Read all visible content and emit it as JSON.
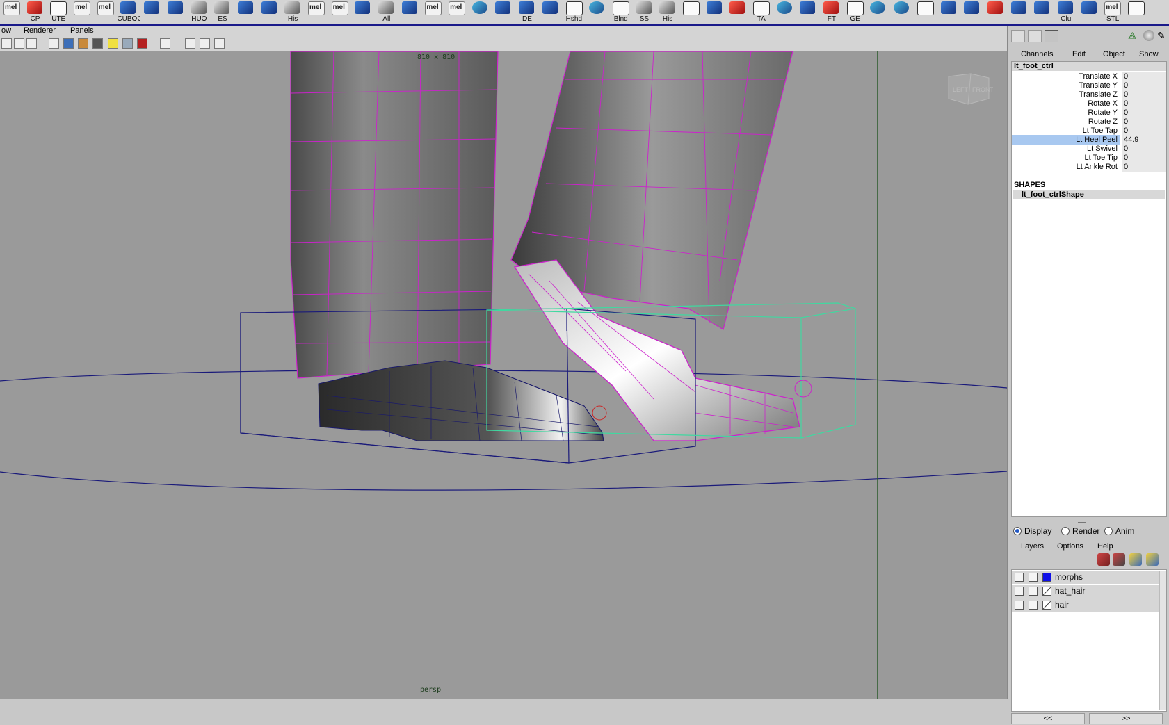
{
  "shelf": {
    "buttons": [
      {
        "label": "",
        "icon": "mel-script-icon",
        "style": "mel"
      },
      {
        "label": "CP",
        "icon": "arrow-red-icon",
        "style": "red"
      },
      {
        "label": "UTE",
        "icon": "window-icon",
        "style": "white"
      },
      {
        "label": "",
        "icon": "mel-script-icon",
        "style": "mel"
      },
      {
        "label": "",
        "icon": "mel-script-icon",
        "style": "mel"
      },
      {
        "label": "CUBOC",
        "icon": "cube-blue-icon",
        "style": "blue"
      },
      {
        "label": "",
        "icon": "plane-blue-icon",
        "style": "blue"
      },
      {
        "label": "",
        "icon": "sphere-wire-icon",
        "style": "blue"
      },
      {
        "label": "HUO",
        "icon": "triangle-gray-icon",
        "style": "gray"
      },
      {
        "label": "ES",
        "icon": "gun-icon",
        "style": "gray"
      },
      {
        "label": "",
        "icon": "bucket-blue-icon",
        "style": "blue"
      },
      {
        "label": "",
        "icon": "grid-blue-icon",
        "style": "blue"
      },
      {
        "label": "His",
        "icon": "flag-gray-icon",
        "style": "gray"
      },
      {
        "label": "",
        "icon": "mel-script-icon",
        "style": "mel"
      },
      {
        "label": "",
        "icon": "mel-script-icon",
        "style": "mel"
      },
      {
        "label": "",
        "icon": "plane-red-icon",
        "style": "blue"
      },
      {
        "label": "All",
        "icon": "triangle-gray-icon",
        "style": "gray"
      },
      {
        "label": "",
        "icon": "box-blue-icon",
        "style": "blue"
      },
      {
        "label": "",
        "icon": "mel-script-icon",
        "style": "mel"
      },
      {
        "label": "",
        "icon": "mel-script-icon",
        "style": "mel"
      },
      {
        "label": "",
        "icon": "joint-grid-icon",
        "style": "teal"
      },
      {
        "label": "",
        "icon": "grid-blue-icon",
        "style": "blue"
      },
      {
        "label": "DE",
        "icon": "plane-blue-icon",
        "style": "blue"
      },
      {
        "label": "",
        "icon": "cursor-grid-icon",
        "style": "blue"
      },
      {
        "label": "Hshd",
        "icon": "window-icon",
        "style": "white"
      },
      {
        "label": "",
        "icon": "sphere-cluster-icon",
        "style": "teal"
      },
      {
        "label": "Blnd",
        "icon": "window-icon",
        "style": "white"
      },
      {
        "label": "SS",
        "icon": "triangle-gray-icon",
        "style": "gray"
      },
      {
        "label": "His",
        "icon": "flag-gray-icon",
        "style": "gray"
      },
      {
        "label": "",
        "icon": "cube-wire-icon",
        "style": "white"
      },
      {
        "label": "",
        "icon": "helmet-blue-icon",
        "style": "blue"
      },
      {
        "label": "",
        "icon": "film-red-icon",
        "style": "red"
      },
      {
        "label": "TA",
        "icon": "window-icon",
        "style": "white"
      },
      {
        "label": "",
        "icon": "globe-green-icon",
        "style": "teal"
      },
      {
        "label": "",
        "icon": "joint-chain-icon",
        "style": "blue"
      },
      {
        "label": "FT",
        "icon": "arrow-red-icon",
        "style": "red"
      },
      {
        "label": "GE",
        "icon": "window-icon",
        "style": "white"
      },
      {
        "label": "",
        "icon": "paint-brush-icon",
        "style": "teal"
      },
      {
        "label": "",
        "icon": "paint-brush-icon",
        "style": "teal"
      },
      {
        "label": "",
        "icon": "cube-wire-icon",
        "style": "white"
      },
      {
        "label": "",
        "icon": "figure-blue-icon",
        "style": "blue"
      },
      {
        "label": "",
        "icon": "sculpt-icon",
        "style": "blue"
      },
      {
        "label": "",
        "icon": "pin-red-icon",
        "style": "red"
      },
      {
        "label": "",
        "icon": "plane-blue-icon",
        "style": "blue"
      },
      {
        "label": "",
        "icon": "plane-stack-icon",
        "style": "blue"
      },
      {
        "label": "Clu",
        "icon": "cluster-icon",
        "style": "blue"
      },
      {
        "label": "",
        "icon": "sculpt-icon",
        "style": "blue"
      },
      {
        "label": "STL",
        "icon": "mel-script-icon",
        "style": "mel"
      },
      {
        "label": "",
        "icon": "scroll-down-icon",
        "style": "white"
      }
    ]
  },
  "panel_menu": [
    "ow",
    "Renderer",
    "Panels"
  ],
  "viewport": {
    "resolution_gate": "810 x 810",
    "camera": "persp",
    "view_cube_labels": [
      "LEFT",
      "FRONT"
    ]
  },
  "channel_box": {
    "menu": [
      "Channels",
      "Edit",
      "Object",
      "Show"
    ],
    "node": "lt_foot_ctrl",
    "attributes": [
      {
        "name": "Translate X",
        "value": "0"
      },
      {
        "name": "Translate Y",
        "value": "0"
      },
      {
        "name": "Translate Z",
        "value": "0"
      },
      {
        "name": "Rotate X",
        "value": "0"
      },
      {
        "name": "Rotate Y",
        "value": "0"
      },
      {
        "name": "Rotate Z",
        "value": "0"
      },
      {
        "name": "Lt Toe Tap",
        "value": "0"
      },
      {
        "name": "Lt Heel Peel",
        "value": "44.9",
        "selected": true
      },
      {
        "name": "Lt Swivel",
        "value": "0"
      },
      {
        "name": "Lt Toe Tip",
        "value": "0"
      },
      {
        "name": "Lt Ankle Rot",
        "value": "0"
      }
    ],
    "shapes_title": "SHAPES",
    "shape_node": "lt_foot_ctrlShape"
  },
  "layer_editor": {
    "modes": [
      {
        "label": "Display",
        "selected": true
      },
      {
        "label": "Render",
        "selected": false
      },
      {
        "label": "Anim",
        "selected": false
      }
    ],
    "menu": [
      "Layers",
      "Options",
      "Help"
    ],
    "layers": [
      {
        "name": "morphs",
        "color": "#1010e8"
      },
      {
        "name": "hat_hair",
        "color": ""
      },
      {
        "name": "hair",
        "color": ""
      }
    ],
    "nav": [
      "<<",
      ">>"
    ]
  },
  "colors": {
    "viewport_bg": "#9a9a9a",
    "selection_wire": "#cc22cc",
    "bounding_box_selected": "#40d8a0",
    "bounding_box": "#1a1a7a",
    "shelf_underline": "#1a1a8a"
  }
}
